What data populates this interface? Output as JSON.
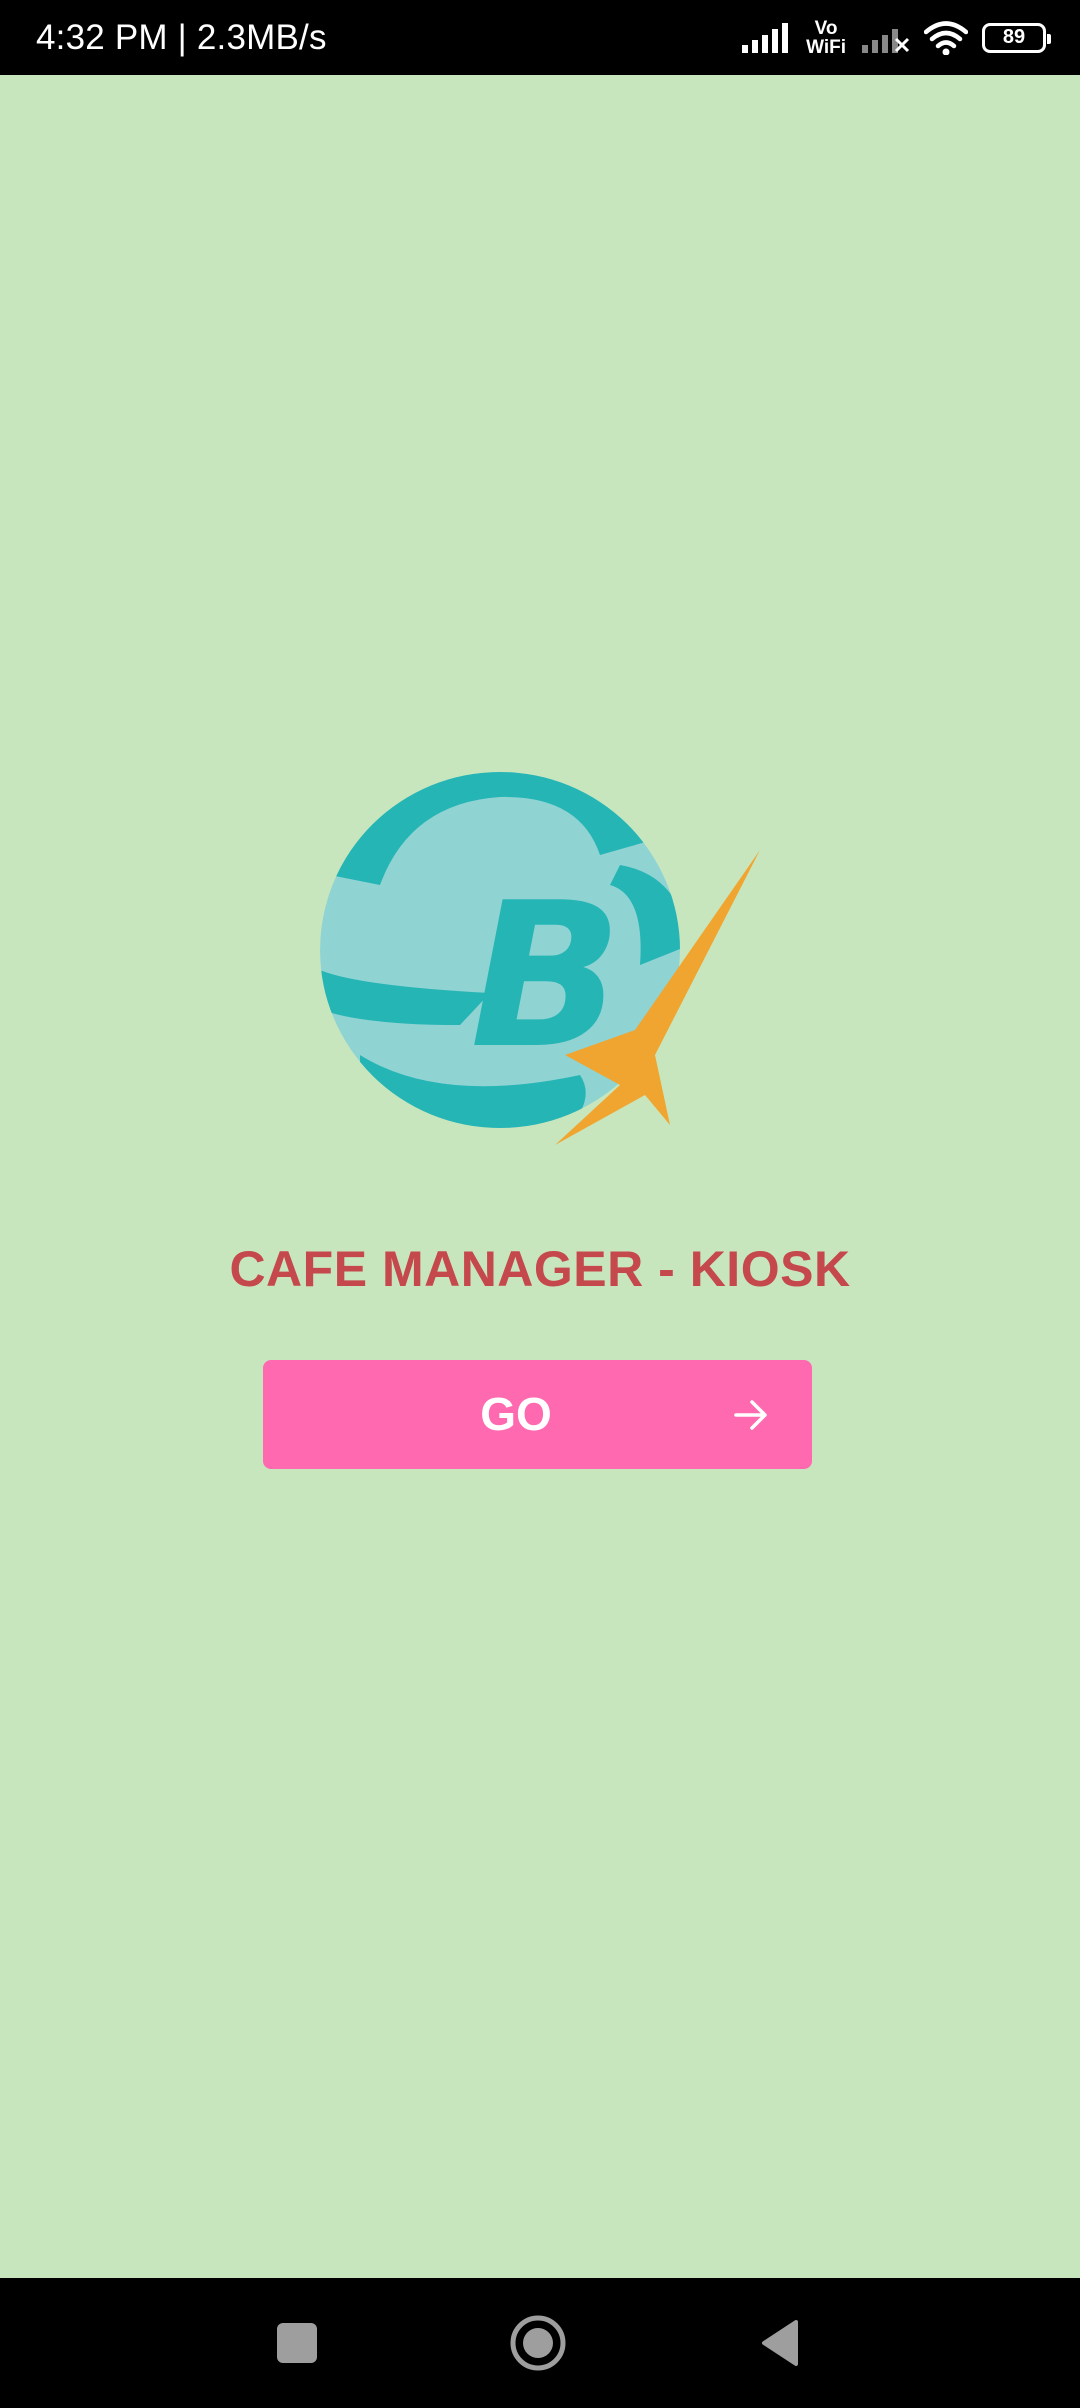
{
  "status_bar": {
    "time_speed": "4:32 PM | 2.3MB/s",
    "vowifi_top": "Vo",
    "vowifi_bottom": "WiFi",
    "battery_level": "89"
  },
  "app": {
    "background_color": "#c8e6bd",
    "logo_letter": "B",
    "title": "CAFE MANAGER - KIOSK",
    "go_button_label": "GO",
    "go_button_icon": "arrow-right-icon",
    "accent_color": "#ff69b0",
    "title_color": "#c5484d"
  },
  "nav_bar": {
    "icons": [
      "recents-square-icon",
      "home-circle-icon",
      "back-triangle-icon"
    ]
  }
}
